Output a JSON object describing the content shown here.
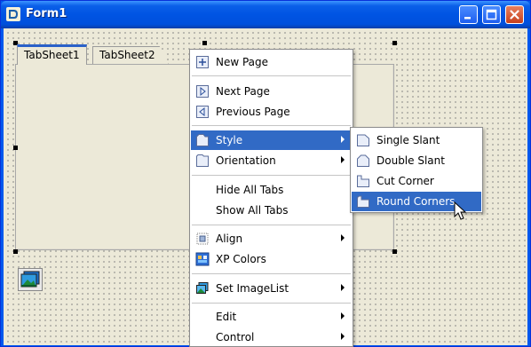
{
  "window": {
    "title": "Form1"
  },
  "tabs": [
    {
      "label": "TabSheet1",
      "active": true
    },
    {
      "label": "TabSheet2",
      "active": false
    }
  ],
  "context_menu": {
    "items": [
      {
        "label": "New Page",
        "icon": "new-page-icon"
      },
      {
        "label": "Next Page",
        "icon": "next-page-icon"
      },
      {
        "label": "Previous Page",
        "icon": "previous-page-icon"
      },
      {
        "label": "Style",
        "icon": "tab-style-icon",
        "submenu": true,
        "highlighted": true
      },
      {
        "label": "Orientation",
        "icon": "orientation-icon",
        "submenu": true
      },
      {
        "label": "Hide All Tabs"
      },
      {
        "label": "Show All Tabs"
      },
      {
        "label": "Align",
        "icon": "align-icon",
        "submenu": true
      },
      {
        "label": "XP Colors",
        "icon": "xp-colors-icon"
      },
      {
        "label": "Set ImageList",
        "icon": "imagelist-icon",
        "submenu": true
      },
      {
        "label": "Edit",
        "submenu": true
      },
      {
        "label": "Control",
        "submenu": true
      }
    ]
  },
  "style_submenu": {
    "items": [
      {
        "label": "Single Slant",
        "icon": "single-slant-icon"
      },
      {
        "label": "Double Slant",
        "icon": "double-slant-icon"
      },
      {
        "label": "Cut Corner",
        "icon": "cut-corner-icon"
      },
      {
        "label": "Round Corners",
        "icon": "round-corners-icon",
        "highlighted": true
      }
    ]
  },
  "colors": {
    "highlight": "#316ac5",
    "titlebar": "#0054e3",
    "form_background": "#ece9d8"
  }
}
